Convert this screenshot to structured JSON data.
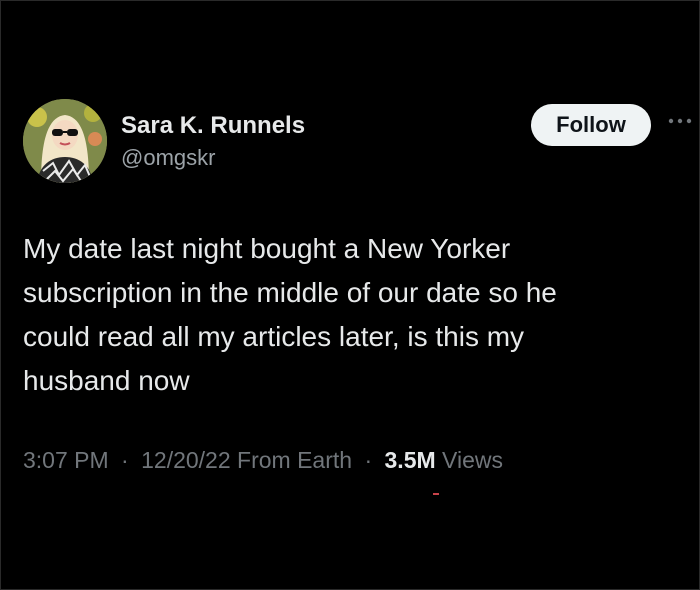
{
  "tweet": {
    "author": {
      "display_name": "Sara K. Runnels",
      "handle": "@omgskr",
      "avatar_icon": "profile-photo"
    },
    "follow_label": "Follow",
    "more_icon": "ellipsis-icon",
    "text": "My date last night bought a New Yorker subscription in the middle of our date so he could read all my articles later, is this my husband now",
    "text_lines": [
      "My date last night bought a New Yorker",
      "subscription in the middle of our date so he",
      "could read all my articles later, is this my",
      "husband now"
    ],
    "meta": {
      "time": "3:07 PM",
      "date": "12/20/22",
      "source": "From Earth",
      "separator": "·",
      "views_count": "3.5M",
      "views_label": "Views"
    }
  },
  "colors": {
    "background": "#000000",
    "primary_text": "#e7e9ea",
    "secondary_text": "#71767b",
    "follow_bg": "#eff3f4"
  }
}
